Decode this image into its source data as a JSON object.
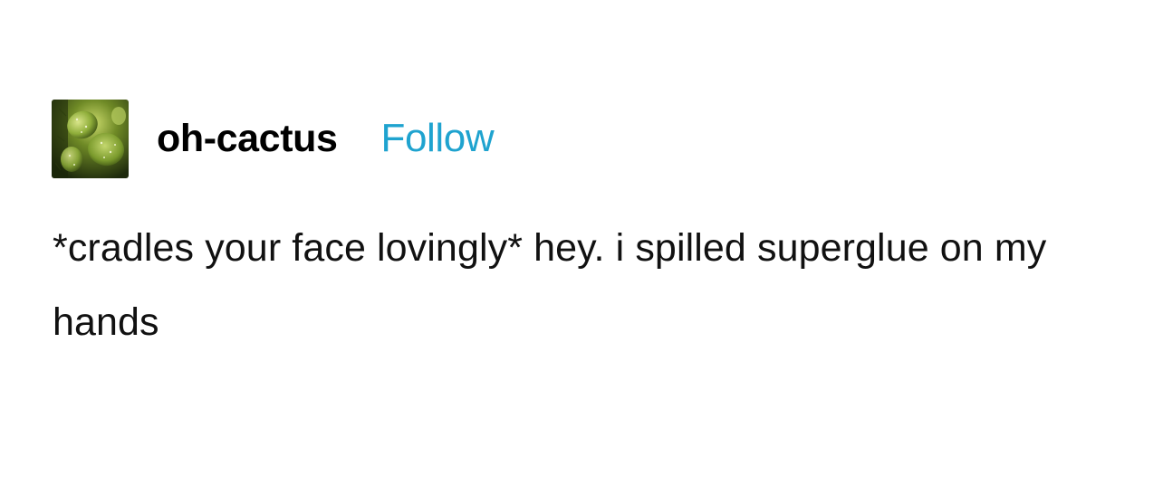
{
  "post": {
    "username": "oh-cactus",
    "follow_label": "Follow",
    "avatar_icon": "cactus-avatar-icon",
    "body_text": "*cradles your face lovingly* hey. i spilled superglue on my hands"
  },
  "colors": {
    "follow": "#1fa3cf",
    "text": "#111111",
    "background": "#ffffff"
  }
}
